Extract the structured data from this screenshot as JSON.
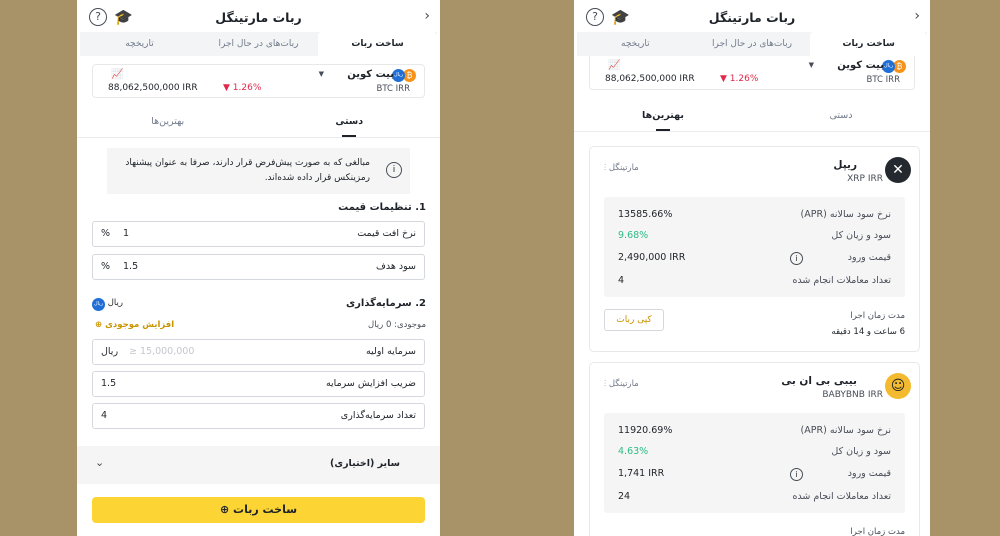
{
  "left": {
    "title": "ربات مارتینگل",
    "tabs": [
      "ساخت ربات",
      "ربات‌های در حال اجرا",
      "تاریخچه"
    ],
    "coin": {
      "name": "بیت کوین",
      "pair": "BTC  IRR",
      "price": "88,062,500,000 IRR",
      "change": "1.26%"
    },
    "modes": [
      "دستی",
      "بهترین‌ها"
    ],
    "note": "مبالغی که به صورت پیش‌فرض قرار دارند، صرفا به عنوان پیشنهاد رمزینکس قرار داده شده‌اند.",
    "price_settings": {
      "heading": "1. تنظیمات قیمت",
      "drop_rate_label": "نرخ افت قیمت",
      "drop_rate_value": "1",
      "target_profit_label": "سود هدف",
      "target_profit_value": "1.5",
      "percent": "%"
    },
    "investment": {
      "heading": "2. سرمایه‌گذاری",
      "currency": "ریال",
      "balance": "موجودی: 0 ریال",
      "increase_balance": "افزایش موجودی",
      "initial_label": "سرمایه اولیه",
      "initial_placeholder": "≥ 15,000,000",
      "initial_unit": "ریال",
      "multiplier_label": "ضریب افزایش سرمایه",
      "multiplier_value": "1.5",
      "count_label": "تعداد سرمایه‌گذاری",
      "count_value": "4"
    },
    "other_label": "سایر (اختیاری)",
    "create_button": "ساخت ربات"
  },
  "right": {
    "title": "ربات مارتینگل",
    "tabs": [
      "ساخت ربات",
      "ربات‌های در حال اجرا",
      "تاریخچه"
    ],
    "coin": {
      "name": "بیت کوین",
      "pair": "BTC  IRR",
      "price": "88,062,500,000 IRR",
      "change": "1.26%"
    },
    "modes": [
      "دستی",
      "بهترین‌ها"
    ],
    "cards": [
      {
        "name": "ریپل",
        "pair": "XRP  IRR",
        "type": "مارتینگل",
        "apr_label": "نرخ سود سالانه (APR)",
        "apr": "13585.66%",
        "pnl_label": "سود و زیان کل",
        "pnl": "9.68%",
        "entry_label": "قیمت ورود",
        "entry": "2,490,000 IRR",
        "trades_label": "تعداد معاملات انجام شده",
        "trades": "4",
        "runtime_label": "مدت زمان اجرا",
        "runtime": "6 ساعت و 14 دقیقه",
        "copy": "کپی ربات"
      },
      {
        "name": "بیبی بی ان بی",
        "pair": "BABYBNB  IRR",
        "type": "مارتینگل",
        "apr_label": "نرخ سود سالانه (APR)",
        "apr": "11920.69%",
        "pnl_label": "سود و زیان کل",
        "pnl": "4.63%",
        "entry_label": "قیمت ورود",
        "entry": "1,741 IRR",
        "trades_label": "تعداد معاملات انجام شده",
        "trades": "24",
        "runtime_label": "مدت زمان اجرا"
      }
    ]
  },
  "colors": {
    "accent": "#fcd535",
    "positive": "#2ebd85",
    "negative": "#e0294a",
    "backdrop": "#a89369"
  }
}
